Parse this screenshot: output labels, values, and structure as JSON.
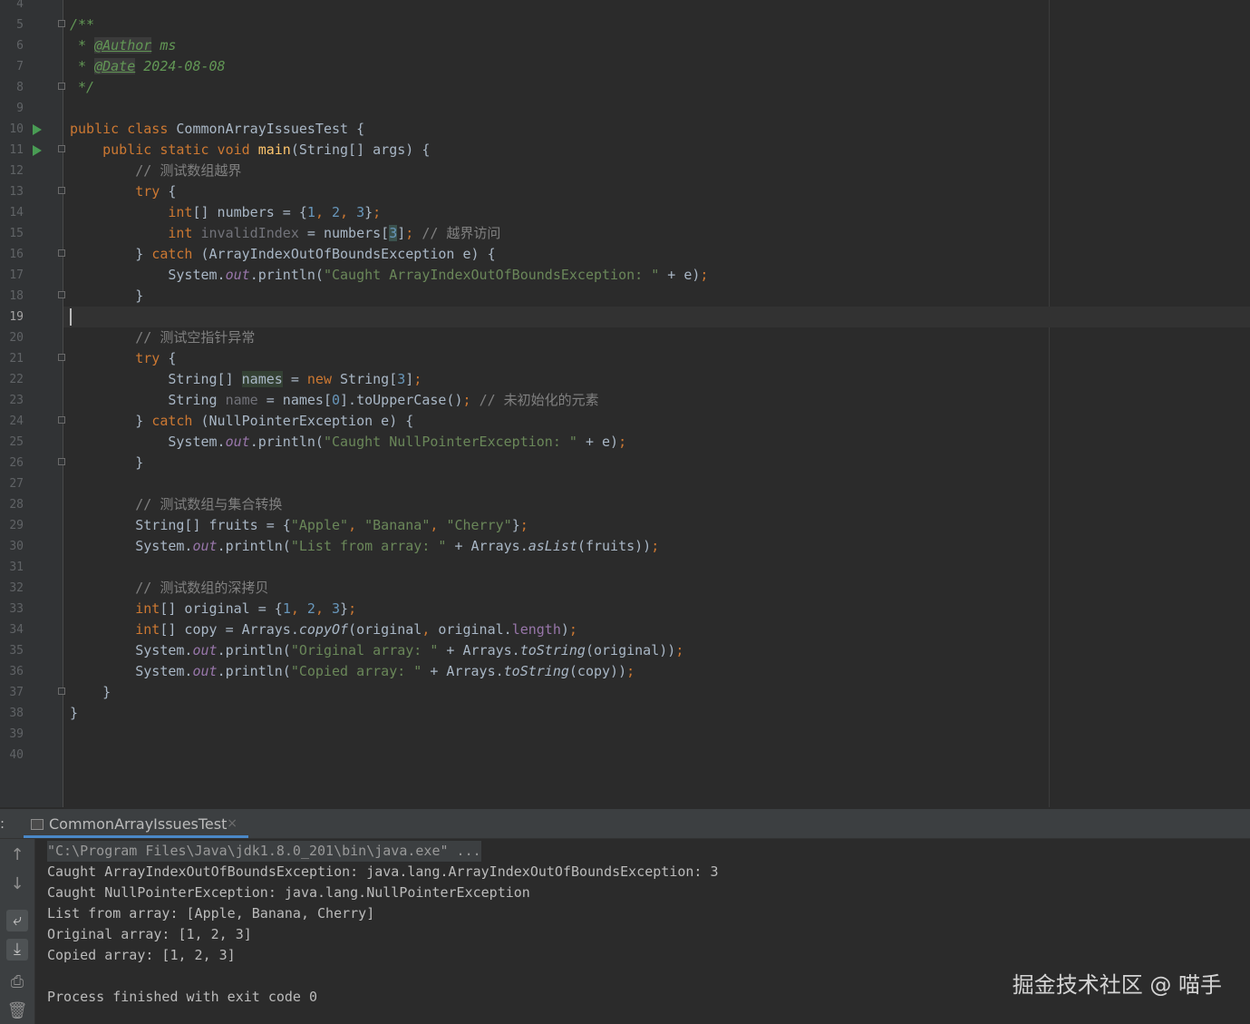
{
  "editor": {
    "lines": [
      {
        "n": "4"
      },
      {
        "n": "5",
        "fold": true,
        "parts": [
          [
            "doc",
            "/**"
          ]
        ]
      },
      {
        "n": "6",
        "parts": [
          [
            "doc",
            " * "
          ],
          [
            "tag",
            "@Author"
          ],
          [
            "doc",
            " ms"
          ]
        ]
      },
      {
        "n": "7",
        "parts": [
          [
            "doc",
            " * "
          ],
          [
            "tag",
            "@Date"
          ],
          [
            "doc",
            " 2024-08-08"
          ]
        ]
      },
      {
        "n": "8",
        "fold": true,
        "parts": [
          [
            "doc",
            " */"
          ]
        ]
      },
      {
        "n": "9"
      },
      {
        "n": "10",
        "run": true,
        "parts": [
          [
            "kw",
            "public class "
          ],
          [
            "",
            "CommonArrayIssuesTest {"
          ]
        ]
      },
      {
        "n": "11",
        "run": true,
        "fold": true,
        "parts": [
          [
            "kw",
            "    public static void "
          ],
          [
            "fn",
            "main"
          ],
          [
            "",
            "(String[] args) {"
          ]
        ]
      },
      {
        "n": "12",
        "parts": [
          [
            "cm",
            "        // 测试数组越界"
          ]
        ]
      },
      {
        "n": "13",
        "fold": true,
        "parts": [
          [
            "kw",
            "        try "
          ],
          [
            "",
            "{"
          ]
        ]
      },
      {
        "n": "14",
        "parts": [
          [
            "kw",
            "            int"
          ],
          [
            "",
            "[] numbers = {"
          ],
          [
            "num",
            "1"
          ],
          [
            "kw",
            ", "
          ],
          [
            "num",
            "2"
          ],
          [
            "kw",
            ", "
          ],
          [
            "num",
            "3"
          ],
          [
            "",
            "}"
          ],
          [
            "kw",
            ";"
          ]
        ]
      },
      {
        "n": "15",
        "parts": [
          [
            "kw",
            "            int "
          ],
          [
            "unused",
            "invalidIndex"
          ],
          [
            "",
            " = numbers["
          ],
          [
            "num br",
            "3"
          ],
          [
            "",
            "]"
          ],
          [
            "kw",
            "; "
          ],
          [
            "cm",
            "// 越界访问"
          ]
        ]
      },
      {
        "n": "16",
        "fold": true,
        "parts": [
          [
            "",
            "        } "
          ],
          [
            "kw",
            "catch "
          ],
          [
            "",
            "(ArrayIndexOutOfBoundsException e) {"
          ]
        ]
      },
      {
        "n": "17",
        "parts": [
          [
            "",
            "            System."
          ],
          [
            "fld",
            "out"
          ],
          [
            "",
            ".println("
          ],
          [
            "str",
            "\"Caught ArrayIndexOutOfBoundsException: \""
          ],
          [
            "",
            " + e)"
          ],
          [
            "kw",
            ";"
          ]
        ]
      },
      {
        "n": "18",
        "fold": true,
        "parts": [
          [
            "",
            "        }"
          ]
        ]
      },
      {
        "n": "19",
        "current": true
      },
      {
        "n": "20",
        "parts": [
          [
            "cm",
            "        // 测试空指针异常"
          ]
        ]
      },
      {
        "n": "21",
        "fold": true,
        "parts": [
          [
            "kw",
            "        try "
          ],
          [
            "",
            "{"
          ]
        ]
      },
      {
        "n": "22",
        "parts": [
          [
            "",
            "            String[] "
          ],
          [
            "hl",
            "names"
          ],
          [
            "",
            " = "
          ],
          [
            "kw",
            "new "
          ],
          [
            "",
            "String["
          ],
          [
            "num",
            "3"
          ],
          [
            "",
            "]"
          ],
          [
            "kw",
            ";"
          ]
        ]
      },
      {
        "n": "23",
        "parts": [
          [
            "",
            "            String "
          ],
          [
            "unused",
            "name"
          ],
          [
            "",
            " = names["
          ],
          [
            "num",
            "0"
          ],
          [
            "",
            "].toUpperCase()"
          ],
          [
            "kw",
            "; "
          ],
          [
            "cm",
            "// 未初始化的元素"
          ]
        ]
      },
      {
        "n": "24",
        "fold": true,
        "parts": [
          [
            "",
            "        } "
          ],
          [
            "kw",
            "catch "
          ],
          [
            "",
            "(NullPointerException e) {"
          ]
        ]
      },
      {
        "n": "25",
        "parts": [
          [
            "",
            "            System."
          ],
          [
            "fld",
            "out"
          ],
          [
            "",
            ".println("
          ],
          [
            "str",
            "\"Caught NullPointerException: \""
          ],
          [
            "",
            " + e)"
          ],
          [
            "kw",
            ";"
          ]
        ]
      },
      {
        "n": "26",
        "fold": true,
        "parts": [
          [
            "",
            "        }"
          ]
        ]
      },
      {
        "n": "27"
      },
      {
        "n": "28",
        "parts": [
          [
            "cm",
            "        // 测试数组与集合转换"
          ]
        ]
      },
      {
        "n": "29",
        "parts": [
          [
            "",
            "        String[] fruits = {"
          ],
          [
            "str",
            "\"Apple\""
          ],
          [
            "kw",
            ", "
          ],
          [
            "str",
            "\"Banana\""
          ],
          [
            "kw",
            ", "
          ],
          [
            "str",
            "\"Cherry\""
          ],
          [
            "",
            "}"
          ],
          [
            "kw",
            ";"
          ]
        ]
      },
      {
        "n": "30",
        "parts": [
          [
            "",
            "        System."
          ],
          [
            "fld",
            "out"
          ],
          [
            "",
            ".println("
          ],
          [
            "str",
            "\"List from array: \""
          ],
          [
            "",
            " + Arrays."
          ],
          [
            "st",
            "asList"
          ],
          [
            "",
            "(fruits))"
          ],
          [
            "kw",
            ";"
          ]
        ]
      },
      {
        "n": "31"
      },
      {
        "n": "32",
        "parts": [
          [
            "cm",
            "        // 测试数组的深拷贝"
          ]
        ]
      },
      {
        "n": "33",
        "parts": [
          [
            "kw",
            "        int"
          ],
          [
            "",
            "[] original = {"
          ],
          [
            "num",
            "1"
          ],
          [
            "kw",
            ", "
          ],
          [
            "num",
            "2"
          ],
          [
            "kw",
            ", "
          ],
          [
            "num",
            "3"
          ],
          [
            "",
            "}"
          ],
          [
            "kw",
            ";"
          ]
        ]
      },
      {
        "n": "34",
        "parts": [
          [
            "kw",
            "        int"
          ],
          [
            "",
            "[] copy = Arrays."
          ],
          [
            "st",
            "copyOf"
          ],
          [
            "",
            "(original"
          ],
          [
            "kw",
            ", "
          ],
          [
            "",
            "original."
          ],
          [
            "memb",
            "length"
          ],
          [
            "",
            ")"
          ],
          [
            "kw",
            ";"
          ]
        ]
      },
      {
        "n": "35",
        "parts": [
          [
            "",
            "        System."
          ],
          [
            "fld",
            "out"
          ],
          [
            "",
            ".println("
          ],
          [
            "str",
            "\"Original array: \""
          ],
          [
            "",
            " + Arrays."
          ],
          [
            "st",
            "toString"
          ],
          [
            "",
            "(original))"
          ],
          [
            "kw",
            ";"
          ]
        ]
      },
      {
        "n": "36",
        "parts": [
          [
            "",
            "        System."
          ],
          [
            "fld",
            "out"
          ],
          [
            "",
            ".println("
          ],
          [
            "str",
            "\"Copied array: \""
          ],
          [
            "",
            " + Arrays."
          ],
          [
            "st",
            "toString"
          ],
          [
            "",
            "(copy))"
          ],
          [
            "kw",
            ";"
          ]
        ]
      },
      {
        "n": "37",
        "fold": true,
        "parts": [
          [
            "",
            "    }"
          ]
        ]
      },
      {
        "n": "38",
        "parts": [
          [
            "",
            "}"
          ]
        ]
      },
      {
        "n": "39"
      },
      {
        "n": "40"
      }
    ]
  },
  "run_panel": {
    "prefix": ":",
    "tab_label": "CommonArrayIssuesTest",
    "close_glyph": "×",
    "output": [
      {
        "text": "\"C:\\Program Files\\Java\\jdk1.8.0_201\\bin\\java.exe\" ...",
        "cmd": true
      },
      {
        "text": "Caught ArrayIndexOutOfBoundsException: java.lang.ArrayIndexOutOfBoundsException: 3"
      },
      {
        "text": "Caught NullPointerException: java.lang.NullPointerException"
      },
      {
        "text": "List from array: [Apple, Banana, Cherry]"
      },
      {
        "text": "Original array: [1, 2, 3]"
      },
      {
        "text": "Copied array: [1, 2, 3]"
      },
      {
        "text": ""
      },
      {
        "text": "Process finished with exit code 0"
      }
    ],
    "tools": [
      {
        "name": "up-arrow-icon",
        "glyph": "↑"
      },
      {
        "name": "down-arrow-icon",
        "glyph": "↓"
      },
      {
        "name": "soft-wrap-icon",
        "glyph": "⤶",
        "on": true
      },
      {
        "name": "scroll-to-end-icon",
        "glyph": "⤓",
        "on": true
      },
      {
        "name": "print-icon",
        "glyph": "⎙"
      },
      {
        "name": "trash-icon",
        "glyph": "🗑"
      }
    ]
  },
  "watermark": "掘金技术社区 @ 喵手"
}
